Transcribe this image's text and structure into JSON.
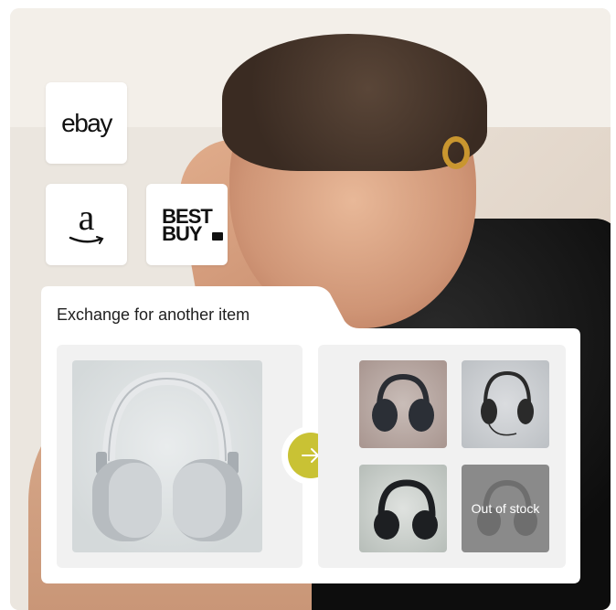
{
  "brands": {
    "ebay_label": "ebay",
    "amazon_label": "a",
    "bestbuy_line1": "BEST",
    "bestbuy_line2": "BUY"
  },
  "exchange": {
    "title": "Exchange for another item",
    "original_item": "over-ear headphones (silver)",
    "alternatives": [
      {
        "name": "black over-ear headphones",
        "available": true
      },
      {
        "name": "wired over-ear headphones",
        "available": true
      },
      {
        "name": "black wireless headphones",
        "available": true
      },
      {
        "name": "headphones",
        "available": false,
        "status": "Out of stock"
      }
    ]
  },
  "colors": {
    "accent": "#c9c234",
    "panel_bg": "#ffffff",
    "box_bg": "#f1f1f1"
  },
  "icons": [
    "ebay-logo-icon",
    "amazon-logo-icon",
    "bestbuy-logo-icon",
    "arrow-right-icon",
    "headphones-icon"
  ]
}
